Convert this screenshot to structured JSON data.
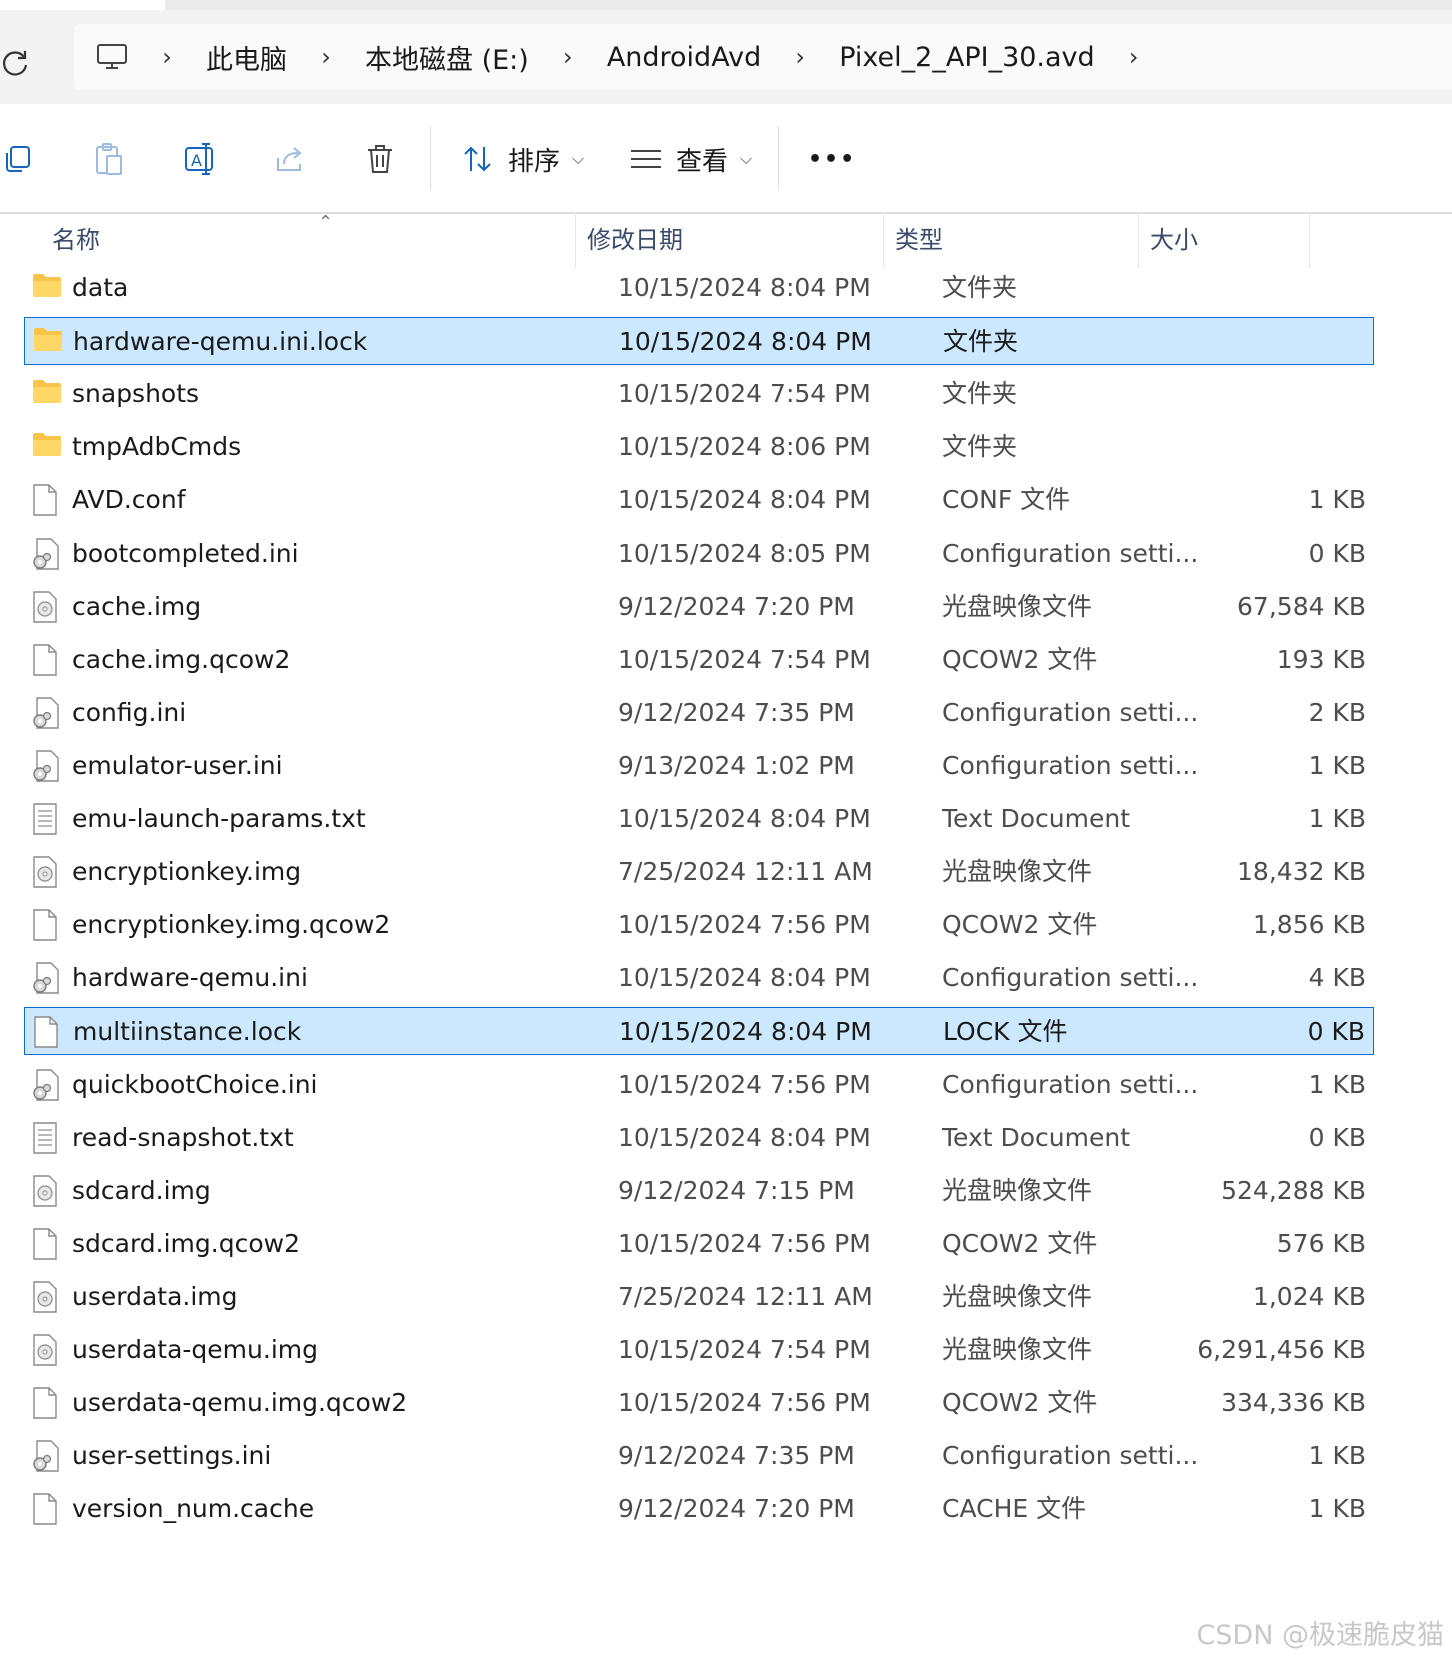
{
  "breadcrumb": {
    "items": [
      "此电脑",
      "本地磁盘 (E:)",
      "AndroidAvd",
      "Pixel_2_API_30.avd"
    ]
  },
  "toolbar": {
    "sort_label": "排序",
    "view_label": "查看",
    "more_label": "•••"
  },
  "columns": {
    "name": "名称",
    "date": "修改日期",
    "type": "类型",
    "size": "大小"
  },
  "files": [
    {
      "name": "data",
      "date": "10/15/2024 8:04 PM",
      "type": "文件夹",
      "size": "",
      "icon": "folder-icon",
      "selected": false
    },
    {
      "name": "hardware-qemu.ini.lock",
      "date": "10/15/2024 8:04 PM",
      "type": "文件夹",
      "size": "",
      "icon": "folder-icon",
      "selected": true
    },
    {
      "name": "snapshots",
      "date": "10/15/2024 7:54 PM",
      "type": "文件夹",
      "size": "",
      "icon": "folder-icon",
      "selected": false
    },
    {
      "name": "tmpAdbCmds",
      "date": "10/15/2024 8:06 PM",
      "type": "文件夹",
      "size": "",
      "icon": "folder-icon",
      "selected": false
    },
    {
      "name": "AVD.conf",
      "date": "10/15/2024 8:04 PM",
      "type": "CONF 文件",
      "size": "1 KB",
      "icon": "file-icon",
      "selected": false
    },
    {
      "name": "bootcompleted.ini",
      "date": "10/15/2024 8:05 PM",
      "type": "Configuration setti...",
      "size": "0 KB",
      "icon": "settings-file-icon",
      "selected": false
    },
    {
      "name": "cache.img",
      "date": "9/12/2024 7:20 PM",
      "type": "光盘映像文件",
      "size": "67,584 KB",
      "icon": "disc-image-icon",
      "selected": false
    },
    {
      "name": "cache.img.qcow2",
      "date": "10/15/2024 7:54 PM",
      "type": "QCOW2 文件",
      "size": "193 KB",
      "icon": "file-icon",
      "selected": false
    },
    {
      "name": "config.ini",
      "date": "9/12/2024 7:35 PM",
      "type": "Configuration setti...",
      "size": "2 KB",
      "icon": "settings-file-icon",
      "selected": false
    },
    {
      "name": "emulator-user.ini",
      "date": "9/13/2024 1:02 PM",
      "type": "Configuration setti...",
      "size": "1 KB",
      "icon": "settings-file-icon",
      "selected": false
    },
    {
      "name": "emu-launch-params.txt",
      "date": "10/15/2024 8:04 PM",
      "type": "Text Document",
      "size": "1 KB",
      "icon": "text-file-icon",
      "selected": false
    },
    {
      "name": "encryptionkey.img",
      "date": "7/25/2024 12:11 AM",
      "type": "光盘映像文件",
      "size": "18,432 KB",
      "icon": "disc-image-icon",
      "selected": false
    },
    {
      "name": "encryptionkey.img.qcow2",
      "date": "10/15/2024 7:56 PM",
      "type": "QCOW2 文件",
      "size": "1,856 KB",
      "icon": "file-icon",
      "selected": false
    },
    {
      "name": "hardware-qemu.ini",
      "date": "10/15/2024 8:04 PM",
      "type": "Configuration setti...",
      "size": "4 KB",
      "icon": "settings-file-icon",
      "selected": false
    },
    {
      "name": "multiinstance.lock",
      "date": "10/15/2024 8:04 PM",
      "type": "LOCK 文件",
      "size": "0 KB",
      "icon": "file-icon",
      "selected": true
    },
    {
      "name": "quickbootChoice.ini",
      "date": "10/15/2024 7:56 PM",
      "type": "Configuration setti...",
      "size": "1 KB",
      "icon": "settings-file-icon",
      "selected": false
    },
    {
      "name": "read-snapshot.txt",
      "date": "10/15/2024 8:04 PM",
      "type": "Text Document",
      "size": "0 KB",
      "icon": "text-file-icon",
      "selected": false
    },
    {
      "name": "sdcard.img",
      "date": "9/12/2024 7:15 PM",
      "type": "光盘映像文件",
      "size": "524,288 KB",
      "icon": "disc-image-icon",
      "selected": false
    },
    {
      "name": "sdcard.img.qcow2",
      "date": "10/15/2024 7:56 PM",
      "type": "QCOW2 文件",
      "size": "576 KB",
      "icon": "file-icon",
      "selected": false
    },
    {
      "name": "userdata.img",
      "date": "7/25/2024 12:11 AM",
      "type": "光盘映像文件",
      "size": "1,024 KB",
      "icon": "disc-image-icon",
      "selected": false
    },
    {
      "name": "userdata-qemu.img",
      "date": "10/15/2024 7:54 PM",
      "type": "光盘映像文件",
      "size": "6,291,456 KB",
      "icon": "disc-image-icon",
      "selected": false
    },
    {
      "name": "userdata-qemu.img.qcow2",
      "date": "10/15/2024 7:56 PM",
      "type": "QCOW2 文件",
      "size": "334,336 KB",
      "icon": "file-icon",
      "selected": false
    },
    {
      "name": "user-settings.ini",
      "date": "9/12/2024 7:35 PM",
      "type": "Configuration setti...",
      "size": "1 KB",
      "icon": "settings-file-icon",
      "selected": false
    },
    {
      "name": "version_num.cache",
      "date": "9/12/2024 7:20 PM",
      "type": "CACHE 文件",
      "size": "1 KB",
      "icon": "file-icon",
      "selected": false
    }
  ],
  "watermark": "CSDN @极速脆皮猫",
  "colors": {
    "selection_bg": "#cce8ff",
    "selection_border": "#0b6cd4",
    "folder": "#f8c54a",
    "header_text": "#3a4a6b"
  }
}
